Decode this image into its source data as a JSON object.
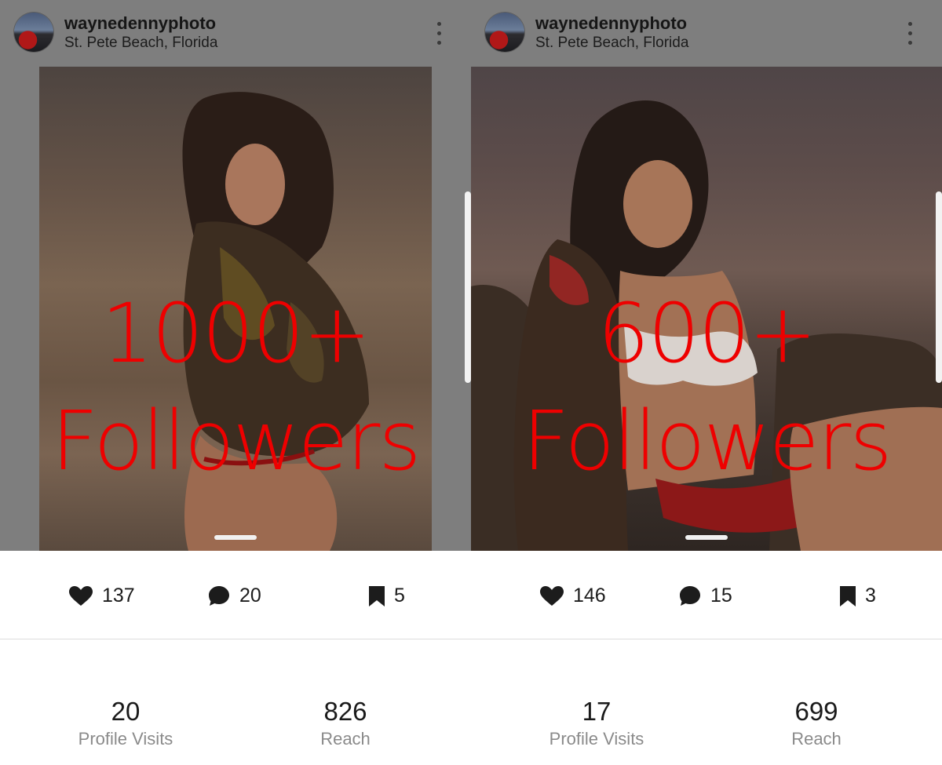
{
  "posts": [
    {
      "username": "waynedennyphoto",
      "location": "St. Pete Beach, Florida",
      "overlay_line1": "1000+",
      "overlay_line2": "Followers",
      "likes": "137",
      "comments": "20",
      "saves": "5",
      "profile_visits_value": "20",
      "profile_visits_label": "Profile Visits",
      "reach_value": "826",
      "reach_label": "Reach"
    },
    {
      "username": "waynedennyphoto",
      "location": "St. Pete Beach, Florida",
      "overlay_line1": "600+",
      "overlay_line2": "Followers",
      "likes": "146",
      "comments": "15",
      "saves": "3",
      "profile_visits_value": "17",
      "profile_visits_label": "Profile Visits",
      "reach_value": "699",
      "reach_label": "Reach"
    }
  ],
  "colors": {
    "overlay_text": "#ee0000",
    "header_dim": "#7e7e7e",
    "secondary_label": "#8a8a8a"
  },
  "icons": [
    "heart-icon",
    "comment-icon",
    "bookmark-icon",
    "more-vertical-icon"
  ]
}
